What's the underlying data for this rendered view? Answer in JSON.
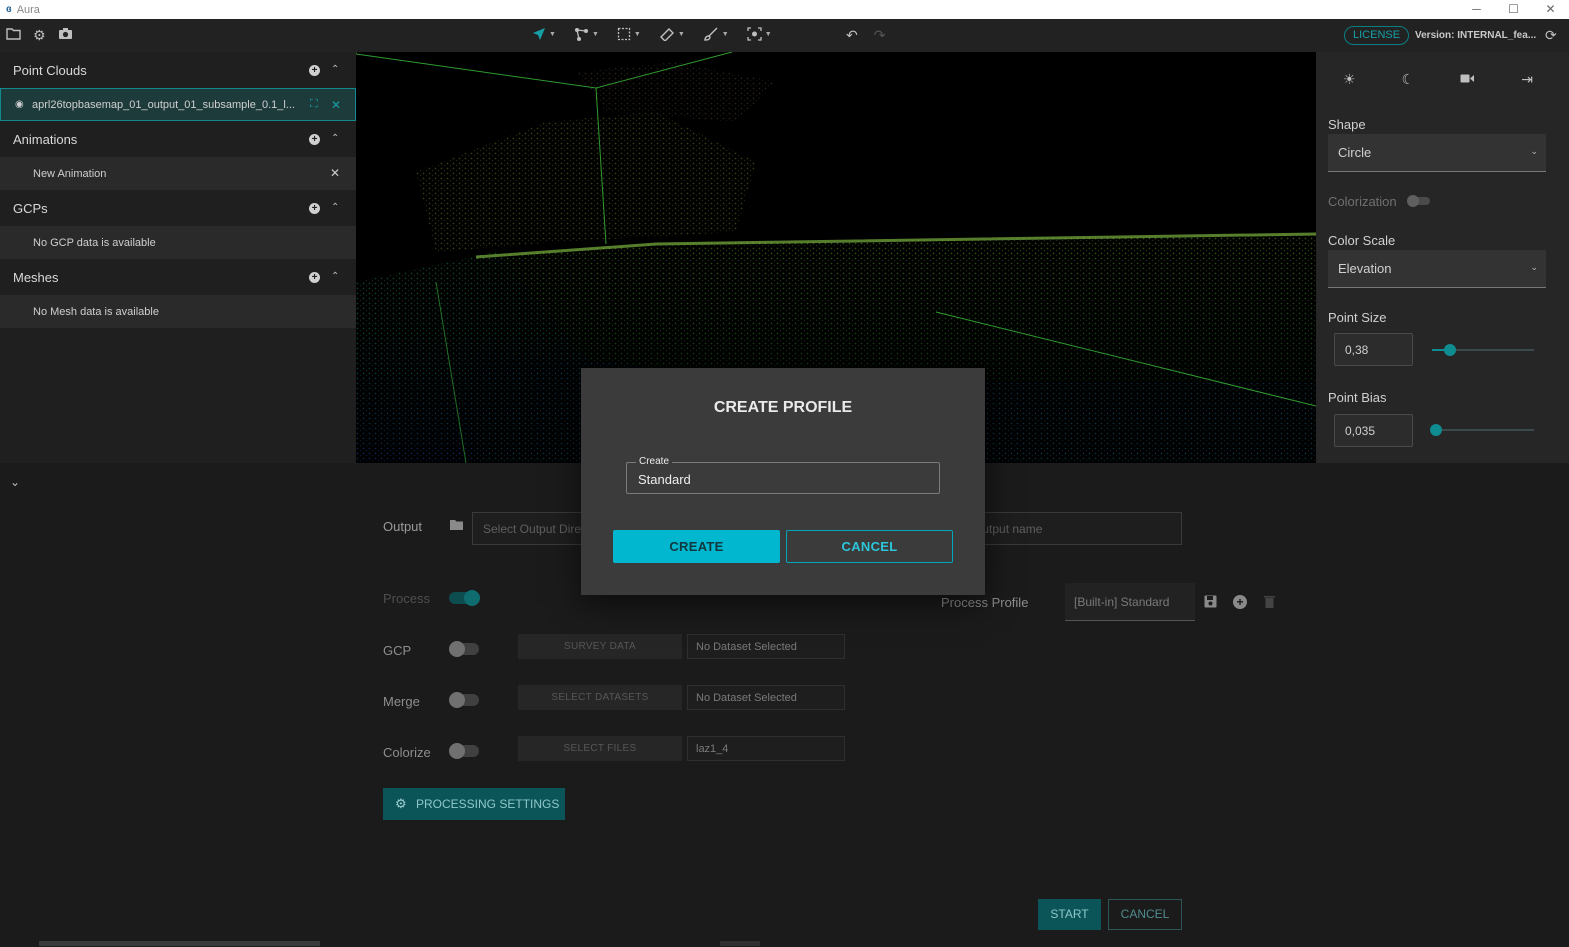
{
  "window": {
    "title": "Aura",
    "logo": "Aura-logo"
  },
  "toolbar": {
    "license": "LICENSE",
    "version": "Version: INTERNAL_fea..."
  },
  "left_panel": {
    "sections": [
      {
        "title": "Point Clouds",
        "items": [
          "aprl26topbasemap_01_output_01_subsample_0.1_l..."
        ]
      },
      {
        "title": "Animations",
        "items": [
          "New Animation"
        ]
      },
      {
        "title": "GCPs",
        "items": [
          "No GCP data is available"
        ]
      },
      {
        "title": "Meshes",
        "items": [
          "No Mesh data is available"
        ]
      }
    ]
  },
  "right_panel": {
    "shape_label": "Shape",
    "shape_value": "Circle",
    "colorization_label": "Colorization",
    "color_scale_label": "Color Scale",
    "color_scale_value": "Elevation",
    "point_size_label": "Point Size",
    "point_size_value": "0,38",
    "point_size_slider_fraction": 0.18,
    "point_bias_label": "Point Bias",
    "point_bias_value": "0,035",
    "point_bias_slider_fraction": 0.04
  },
  "bottom": {
    "output_label": "Output",
    "output_dir_placeholder": "Select Output Directory",
    "output_name_placeholder": "Output name",
    "process_label": "Process",
    "process_profile_label": "Process Profile",
    "process_profile_value": "[Built-in] Standard",
    "gcp_label": "GCP",
    "gcp_button": "SURVEY DATA",
    "gcp_value": "No Dataset Selected",
    "merge_label": "Merge",
    "merge_button": "SELECT DATASETS",
    "merge_value": "No Dataset Selected",
    "colorize_label": "Colorize",
    "colorize_button": "SELECT FILES",
    "colorize_value": "laz1_4",
    "processing_settings": "PROCESSING SETTINGS",
    "start": "START",
    "cancel": "CANCEL"
  },
  "modal": {
    "title": "CREATE PROFILE",
    "field_label": "Create",
    "field_value": "Standard",
    "create_button": "CREATE",
    "cancel_button": "CANCEL"
  },
  "colors": {
    "accent": "#00b7cf",
    "teal_dark": "#0b5457",
    "panel": "#1f1f1f",
    "modal": "#3b3b3b"
  }
}
